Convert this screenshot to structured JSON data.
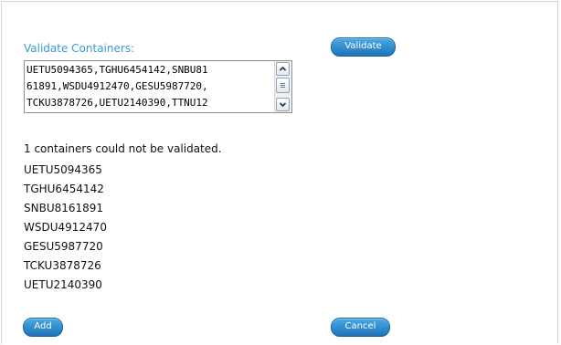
{
  "form": {
    "label": "Validate Containers:",
    "validate_label": "Validate",
    "input_lines": [
      "UETU5094365,TGHU6454142,SNBU81",
      "61891,WSDU4912470,GESU5987720,",
      "TCKU3878726,UETU2140390,TTNU12"
    ]
  },
  "result": {
    "message": "1 containers could not be validated.",
    "items": [
      "UETU5094365",
      "TGHU6454142",
      "SNBU8161891",
      "WSDU4912470",
      "GESU5987720",
      "TCKU3878726",
      "UETU2140390"
    ]
  },
  "actions": {
    "add_label": "Add",
    "cancel_label": "Cancel"
  },
  "colors": {
    "label": "#3a9ad6",
    "button_top": "#4aa9e3",
    "button_bottom": "#1e73b8"
  }
}
